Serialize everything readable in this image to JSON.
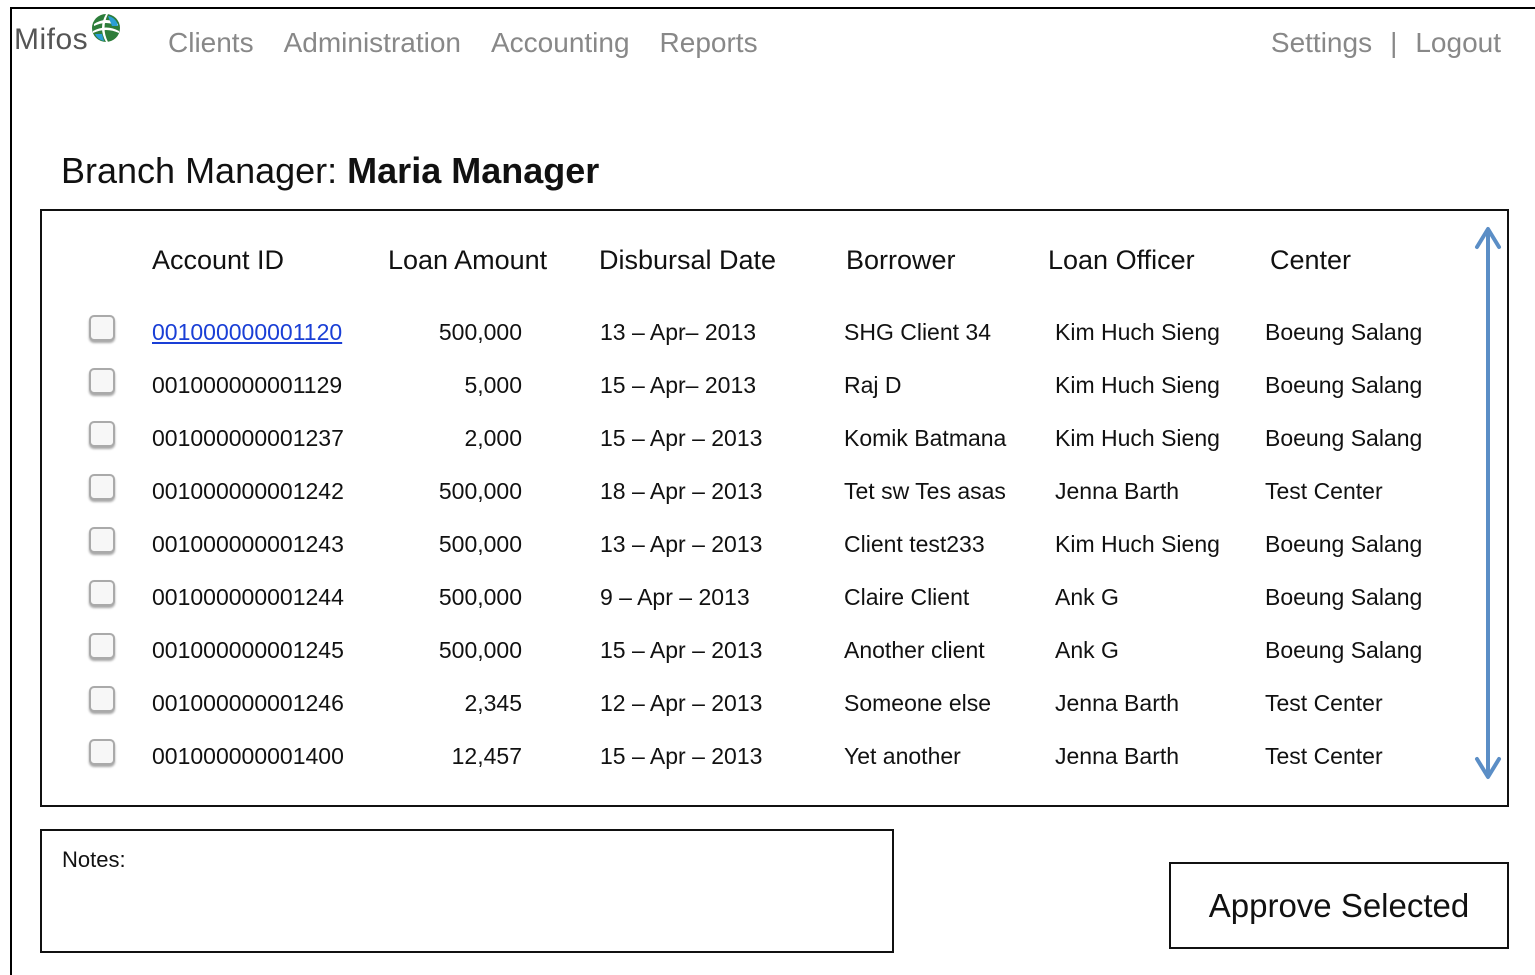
{
  "brand": {
    "logo_text": "Mifos"
  },
  "nav": {
    "items": [
      {
        "label": "Clients"
      },
      {
        "label": "Administration"
      },
      {
        "label": "Accounting"
      },
      {
        "label": "Reports"
      }
    ]
  },
  "top_right": {
    "settings": "Settings",
    "separator": "|",
    "logout": "Logout"
  },
  "page": {
    "heading_prefix": "Branch Manager:",
    "heading_name": "Maria Manager"
  },
  "table": {
    "headers": [
      "Account ID",
      "Loan Amount",
      "Disbursal Date",
      "Borrower",
      "Loan Officer",
      "Center"
    ],
    "rows": [
      {
        "account_id": "001000000001120",
        "amount": "500,000",
        "date": "13 – Apr– 2013",
        "borrower": "SHG Client 34",
        "officer": "Kim Huch Sieng",
        "center": "Boeung Salang"
      },
      {
        "account_id": "001000000001129",
        "amount": "5,000",
        "date": "15 – Apr– 2013",
        "borrower": "Raj D",
        "officer": "Kim Huch Sieng",
        "center": "Boeung Salang"
      },
      {
        "account_id": "001000000001237",
        "amount": "2,000",
        "date": "15 – Apr – 2013",
        "borrower": "Komik Batmana",
        "officer": "Kim Huch Sieng",
        "center": "Boeung Salang"
      },
      {
        "account_id": "001000000001242",
        "amount": "500,000",
        "date": "18 – Apr – 2013",
        "borrower": "Tet sw Tes asas",
        "officer": "Jenna Barth",
        "center": "Test Center"
      },
      {
        "account_id": "001000000001243",
        "amount": "500,000",
        "date": "13 – Apr – 2013",
        "borrower": "Client test233",
        "officer": "Kim Huch Sieng",
        "center": "Boeung Salang"
      },
      {
        "account_id": "001000000001244",
        "amount": "500,000",
        "date": "9 – Apr – 2013",
        "borrower": "Claire Client",
        "officer": "Ank G",
        "center": "Boeung Salang"
      },
      {
        "account_id": "001000000001245",
        "amount": "500,000",
        "date": "15 – Apr – 2013",
        "borrower": "Another client",
        "officer": "Ank G",
        "center": "Boeung Salang"
      },
      {
        "account_id": "001000000001246",
        "amount": "2,345",
        "date": "12 – Apr – 2013",
        "borrower": "Someone else",
        "officer": "Jenna Barth",
        "center": "Test Center"
      },
      {
        "account_id": "001000000001400",
        "amount": "12,457",
        "date": "15 – Apr – 2013",
        "borrower": "Yet another",
        "officer": "Jenna Barth",
        "center": "Test Center"
      }
    ]
  },
  "notes": {
    "label": "Notes:"
  },
  "actions": {
    "approve_label": "Approve Selected"
  },
  "colors": {
    "link": "#1a3fd6",
    "scroll_arrow": "#5b8ec6",
    "nav_text": "#888888"
  }
}
